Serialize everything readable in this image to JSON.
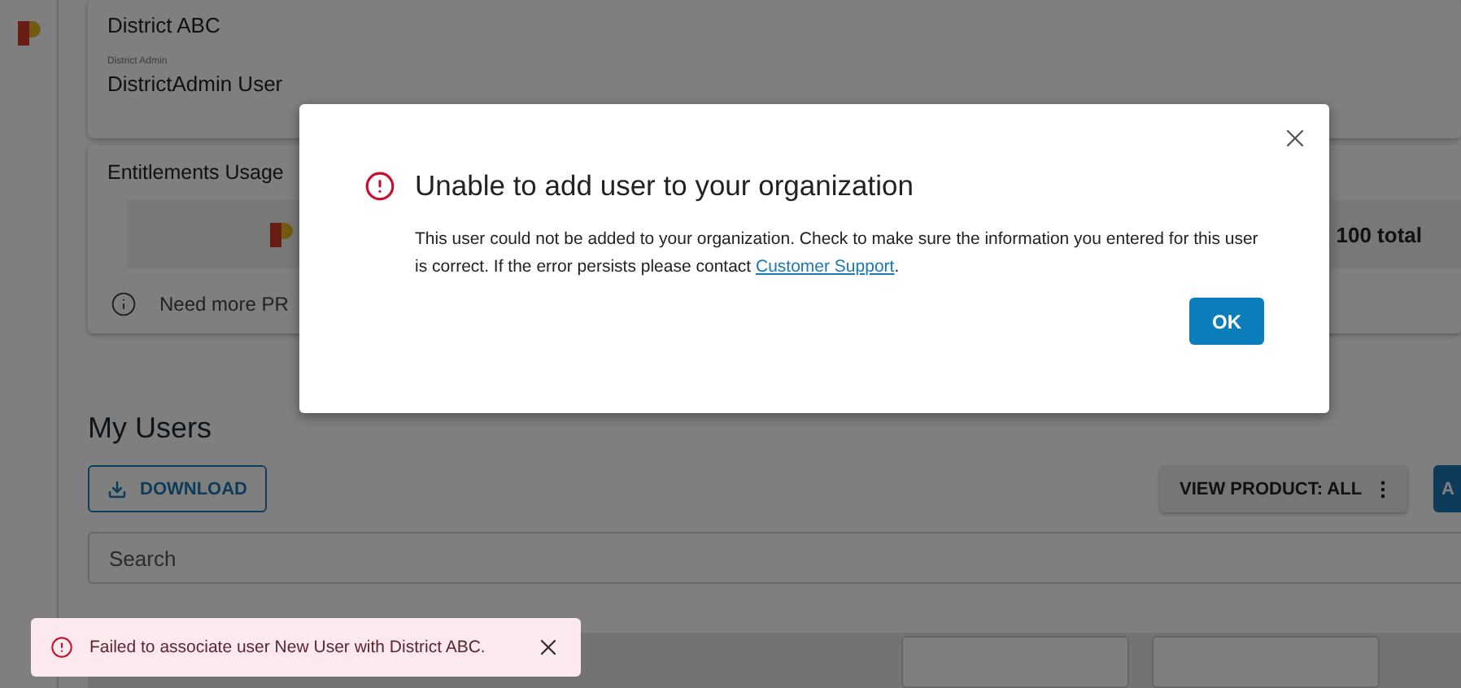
{
  "organization": {
    "name": "District ABC",
    "admin_label": "District Admin",
    "admin_name": "DistrictAdmin User"
  },
  "entitlements": {
    "title": "Entitlements Usage",
    "total": "100 total",
    "info": "Need more PR"
  },
  "users": {
    "title": "My Users",
    "download": "DOWNLOAD",
    "view_product": "VIEW PRODUCT: ALL",
    "add_button": "A",
    "search": {
      "placeholder": "Search"
    }
  },
  "modal": {
    "title": "Unable to add user to your organization",
    "body": "This user could not be added to your organization. Check to make sure the information you entered for this user is correct. If the error persists please contact ",
    "link": "Customer Support",
    "after_link": ".",
    "ok": "OK"
  },
  "toast": {
    "message": "Failed to associate user New User with District ABC."
  }
}
